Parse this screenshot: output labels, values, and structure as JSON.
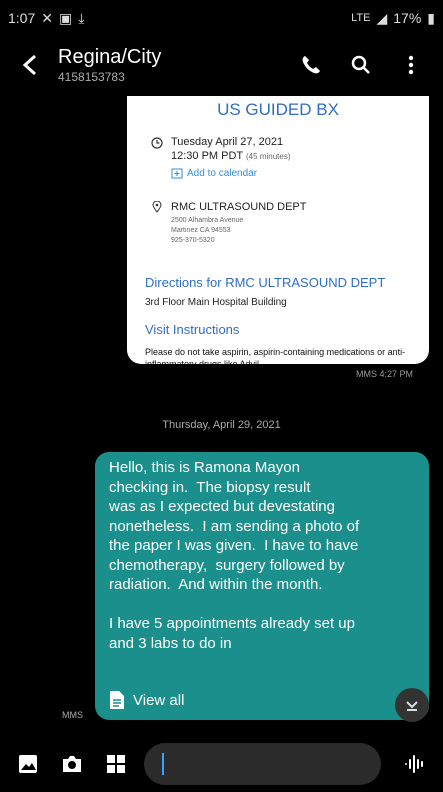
{
  "status": {
    "time": "1:07",
    "network": "LTE",
    "battery": "17%"
  },
  "header": {
    "contact_name": "Regina/City",
    "contact_number": "4158153783"
  },
  "card": {
    "title": "US GUIDED BX",
    "date": "Tuesday April 27, 2021",
    "time": "12:30 PM PDT",
    "duration": "(45 minutes)",
    "add_to_calendar": "Add to calendar",
    "dept_name": "RMC ULTRASOUND DEPT",
    "address_line1": "2500 Alhambra Avenue",
    "address_line2": "Martinez CA 94553",
    "phone": "925-370-5320",
    "directions": "Directions for RMC ULTRASOUND DEPT",
    "floor": "3rd Floor Main Hospital Building",
    "visit_instructions": "Visit Instructions",
    "warning": "Please do not take aspirin, aspirin-containing medications or anti-inflammatory drugs like Advil"
  },
  "mms_time": "MMS 4:27 PM",
  "date_separator": "Thursday, April 29, 2021",
  "message": {
    "text": "Hello, this is Ramona Mayon\nchecking in.  The biopsy result\nwas as I expected but devestating\nnonetheless.  I am sending a photo of\nthe paper I was given.  I have to have\nchemotherapy,  surgery followed by\nradiation.  And within the month.\n\nI have 5 appointments already set up\nand 3 labs to do in",
    "view_all": "View all",
    "mms_label": "MMS"
  },
  "composer": {
    "placeholder": ""
  },
  "colors": {
    "bubble": "#1a8f8c",
    "link": "#2f6ec4",
    "background": "#000000"
  },
  "icons": [
    "back-arrow-icon",
    "phone-icon",
    "search-icon",
    "more-vert-icon",
    "gallery-icon",
    "camera-icon",
    "apps-grid-icon",
    "voice-icon",
    "scroll-down-icon",
    "document-icon"
  ]
}
